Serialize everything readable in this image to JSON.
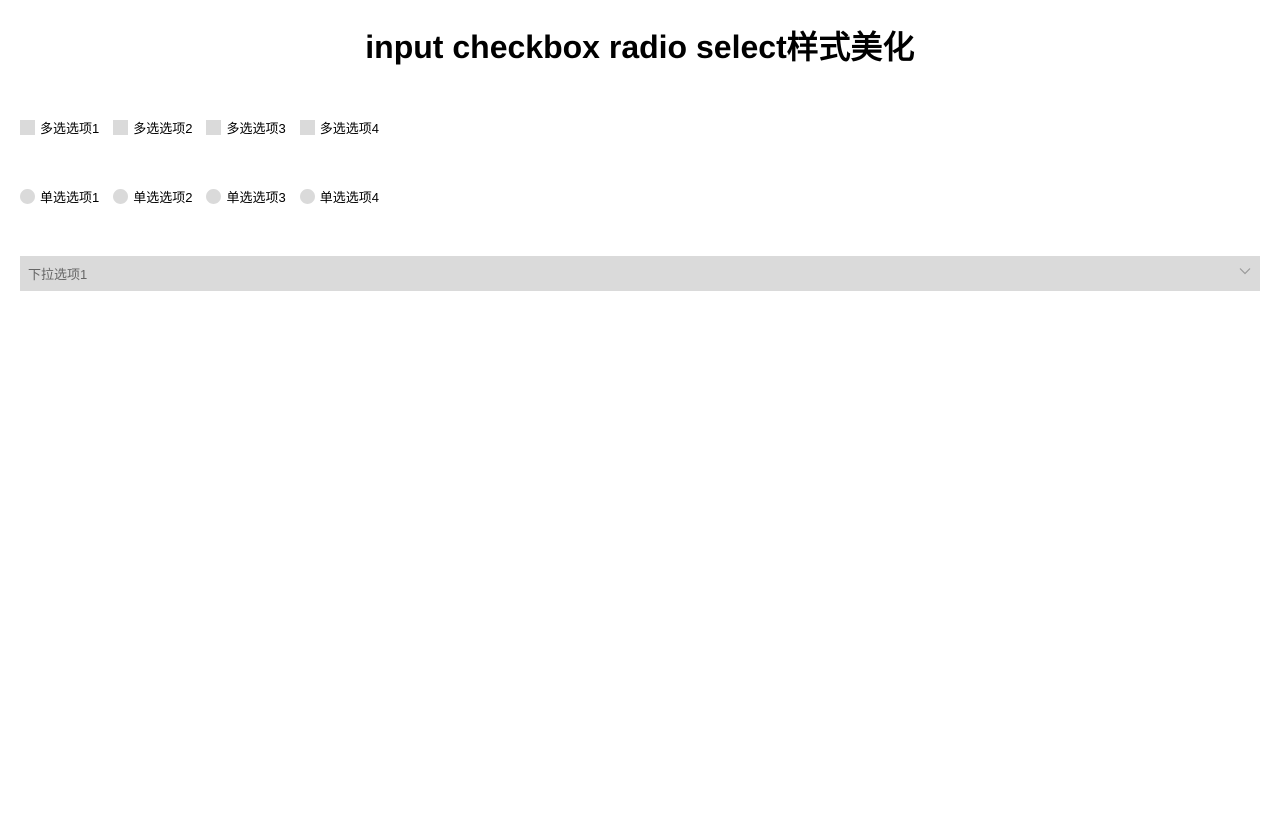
{
  "title": "input checkbox radio select样式美化",
  "checkboxes": [
    {
      "label": "多选选项1"
    },
    {
      "label": "多选选项2"
    },
    {
      "label": "多选选项3"
    },
    {
      "label": "多选选项4"
    }
  ],
  "radios": [
    {
      "label": "单选选项1"
    },
    {
      "label": "单选选项2"
    },
    {
      "label": "单选选项3"
    },
    {
      "label": "单选选项4"
    }
  ],
  "select": {
    "selected": "下拉选项1"
  }
}
